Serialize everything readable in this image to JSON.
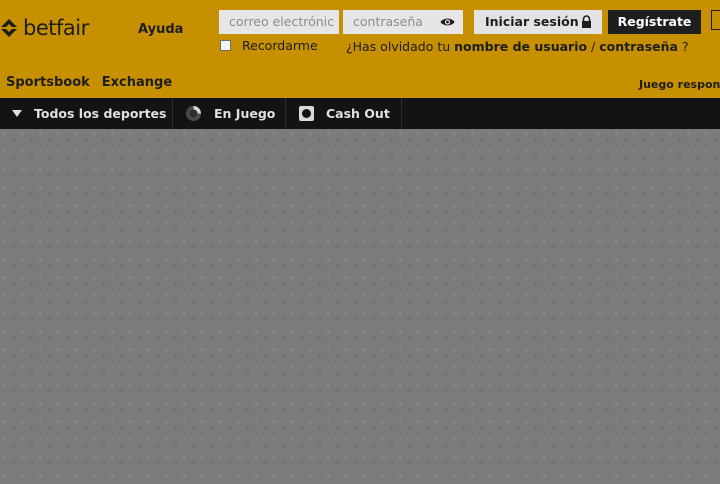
{
  "brand": {
    "name": "betfair"
  },
  "header": {
    "help_label": "Ayuda",
    "email_placeholder": "correo electrónic",
    "password_placeholder": "contraseña",
    "login_label": "Iniciar sesión",
    "register_label": "Regístrate",
    "remember_label": "Recordarme",
    "forgot_prefix": "¿Has olvidado tu ",
    "forgot_username": "nombre de usuario",
    "forgot_separator": " / ",
    "forgot_password": "contraseña",
    "forgot_suffix": " ?"
  },
  "nav": {
    "sportsbook": "Sportsbook",
    "exchange": "Exchange",
    "responsible": "Juego respon"
  },
  "sportsbar": {
    "all_sports": "Todos los deportes",
    "in_play": "En Juego",
    "cash_out": "Cash Out"
  },
  "colors": {
    "header_bg": "#c69000",
    "bar_bg": "#131313",
    "main_bg": "#7b7b7b"
  }
}
